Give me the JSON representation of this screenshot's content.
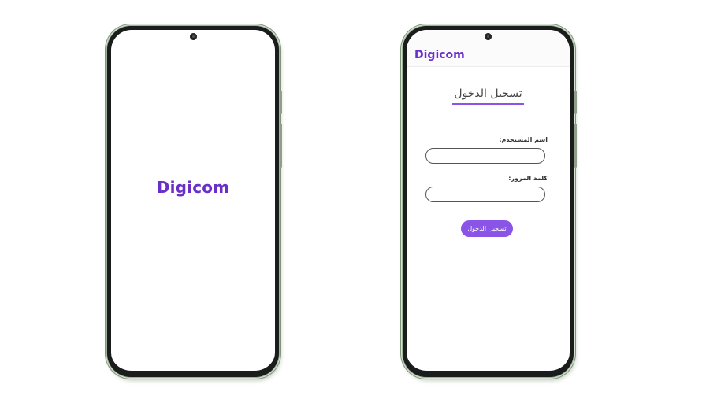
{
  "colors": {
    "brand": "#6a2fc8",
    "accent": "#8a55e6"
  },
  "splash": {
    "brand": "Digicom"
  },
  "login": {
    "header_brand": "Digicom",
    "title": "تسجيل الدخول",
    "username_label": "اسم المستخدم:",
    "username_value": "",
    "password_label": "كلمة المرور:",
    "password_value": "",
    "submit_label": "تسجيل الدخول"
  }
}
